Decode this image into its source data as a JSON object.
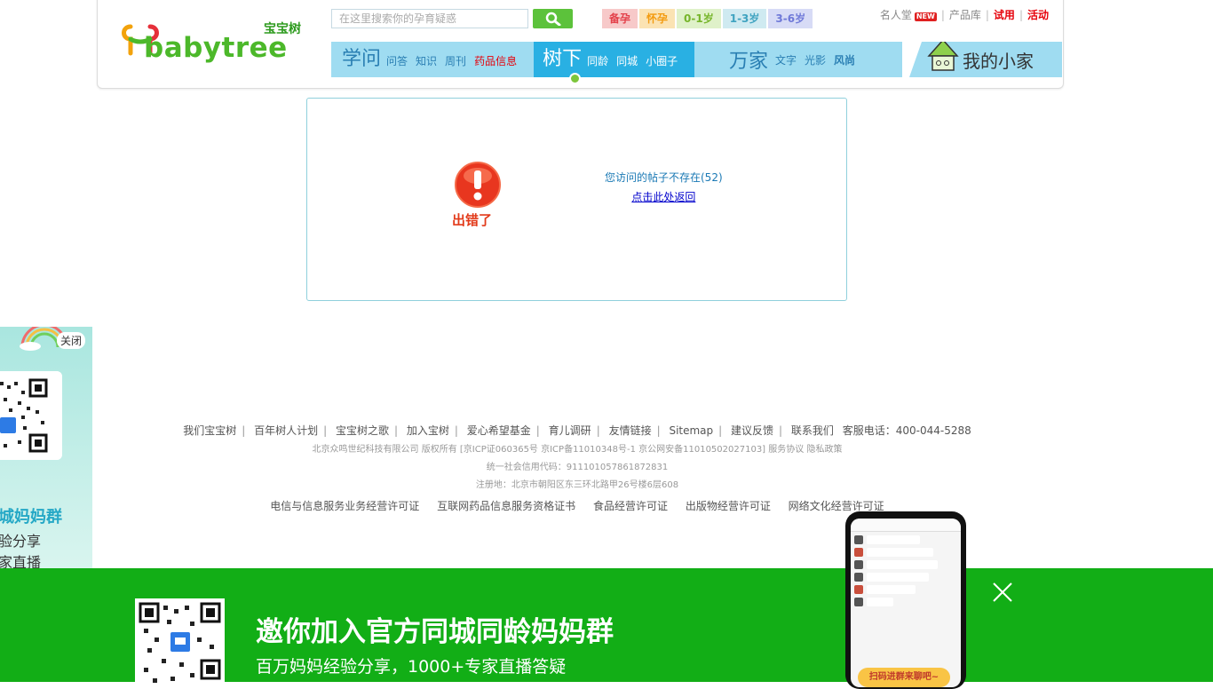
{
  "header": {
    "logo_cn": "宝宝树",
    "logo_en": "babytree",
    "search_placeholder": "在这里搜索你的孕育疑惑",
    "age_tags": [
      {
        "label": "备孕",
        "color": "#e3404a",
        "bg": "#f7c9c9"
      },
      {
        "label": "怀孕",
        "color": "#f39b10",
        "bg": "#fbe3b3"
      },
      {
        "label": "0-1岁",
        "color": "#76b52a",
        "bg": "#dff1c9"
      },
      {
        "label": "1-3岁",
        "color": "#3fa3c0",
        "bg": "#cfeaf1"
      },
      {
        "label": "3-6岁",
        "color": "#6f79d8",
        "bg": "#d7dbf6"
      }
    ],
    "top_links": {
      "hall_of_fame": "名人堂",
      "new_badge": "NEW",
      "product_library": "产品库",
      "trial": "试用",
      "activity": "活动"
    },
    "nav": {
      "xuewen": {
        "main": "学问",
        "subs": [
          "问答",
          "知识",
          "周刊"
        ],
        "red_sub": "药品信息"
      },
      "shuxia": {
        "main": "树下",
        "subs": [
          "同龄",
          "同城",
          "小圈子"
        ]
      },
      "wanjia": {
        "main": "万家",
        "subs": [
          "文字",
          "光影"
        ],
        "bold_sub": "风尚"
      },
      "my_home": "我的小家"
    }
  },
  "error": {
    "label": "出错了",
    "message": "您访问的帖子不存在(52)",
    "back_link": "点击此处返回"
  },
  "footer": {
    "links": [
      "我们宝宝树",
      "百年树人计划",
      "宝宝树之歌",
      "加入宝树",
      "爱心希望基金",
      "育儿调研",
      "友情链接",
      "Sitemap",
      "建议反馈",
      "联系我们"
    ],
    "hotline": "客服电话：400-044-5288",
    "copyright": "北京众鸣世纪科技有限公司 版权所有 [京ICP证060365号 京ICP备11010348号-1 京公网安备11010502027103] 服务协议 隐私政策",
    "credit_code": "统一社会信用代码：911101057861872831",
    "address": "注册地：北京市朝阳区东三环北路甲26号楼6层608",
    "licenses": [
      "电信与信息服务业务经营许可证",
      "互联网药品信息服务资格证书",
      "食品经营许可证",
      "出版物经营许可证",
      "网络文化经营许可证"
    ]
  },
  "side_ad": {
    "close": "关闭",
    "line1": "城妈妈群",
    "line2": "验分享",
    "line3": "家直播"
  },
  "banner": {
    "title": "邀你加入官方同城同龄妈妈群",
    "subtitle": "百万妈妈经验分享，1000+专家直播答疑",
    "phone_cta": "扫码进群来聊吧~",
    "bg_color": "#12ae16"
  }
}
